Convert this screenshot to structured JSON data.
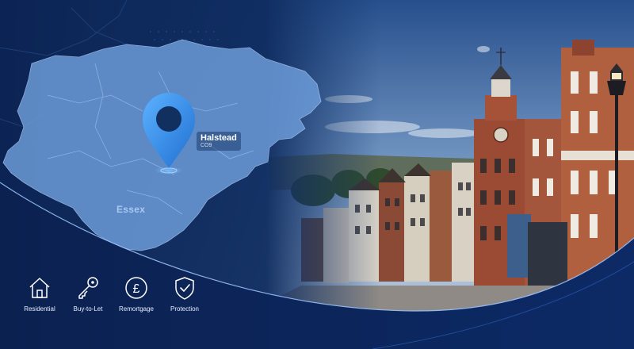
{
  "location": {
    "town": "Halstead",
    "postcode": "CO9",
    "region": "Essex"
  },
  "services": [
    {
      "label": "Residential",
      "icon": "house-icon"
    },
    {
      "label": "Buy-to-Let",
      "icon": "key-icon"
    },
    {
      "label": "Remortgage",
      "icon": "pound-coin-icon"
    },
    {
      "label": "Protection",
      "icon": "shield-check-icon"
    }
  ],
  "colors": {
    "navy": "#0a1f4a",
    "accent_blue": "#3d8fe6",
    "map_fill": "#6f9fdc"
  }
}
